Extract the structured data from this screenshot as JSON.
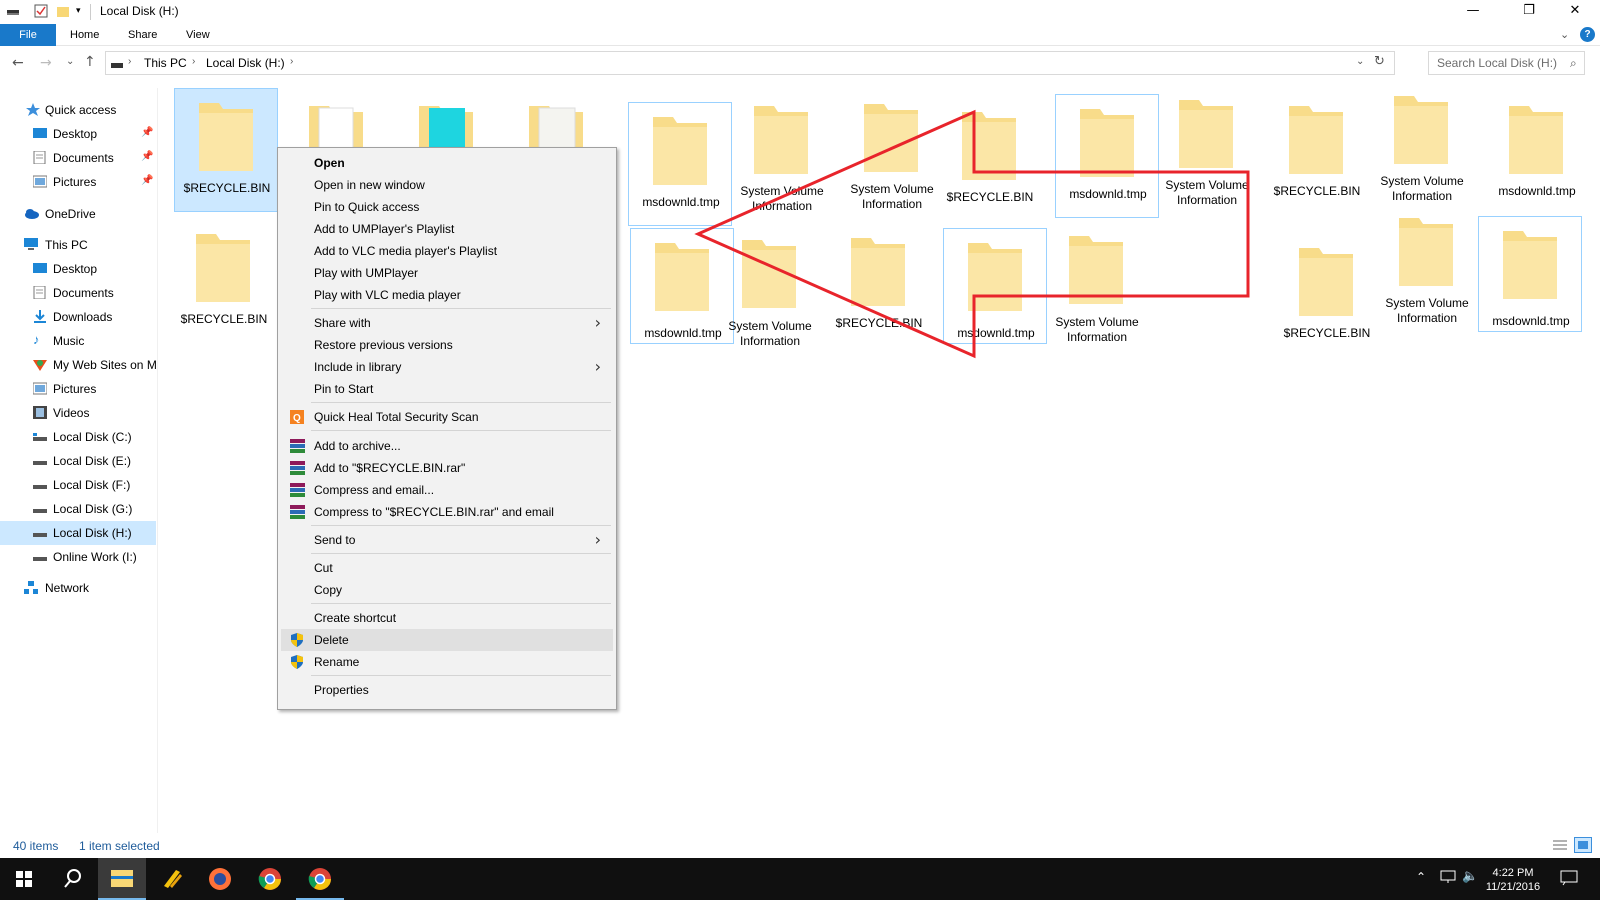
{
  "window": {
    "title": "Local Disk (H:)",
    "minimize": "—",
    "maximize": "❐",
    "close": "✕"
  },
  "ribbon": {
    "tabs": [
      "File",
      "Home",
      "Share",
      "View"
    ]
  },
  "address": {
    "crumbs": [
      "This PC",
      "Local Disk (H:)"
    ],
    "search_placeholder": "Search Local Disk (H:)"
  },
  "nav": {
    "items": [
      {
        "label": "Quick access",
        "icon": "star-icon"
      },
      {
        "label": "Desktop",
        "icon": "desktop-icon"
      },
      {
        "label": "Documents",
        "icon": "documents-icon"
      },
      {
        "label": "Pictures",
        "icon": "pictures-icon"
      },
      {
        "label": "OneDrive",
        "icon": "cloud-icon"
      },
      {
        "label": "This PC",
        "icon": "computer-icon"
      },
      {
        "label": "Desktop",
        "icon": "desktop-icon"
      },
      {
        "label": "Documents",
        "icon": "documents-icon"
      },
      {
        "label": "Downloads",
        "icon": "downloads-icon"
      },
      {
        "label": "Music",
        "icon": "music-icon"
      },
      {
        "label": "My Web Sites on M",
        "icon": "web-sites-icon"
      },
      {
        "label": "Pictures",
        "icon": "pictures-icon"
      },
      {
        "label": "Videos",
        "icon": "videos-icon"
      },
      {
        "label": "Local Disk (C:)",
        "icon": "drive-icon"
      },
      {
        "label": "Local Disk (E:)",
        "icon": "drive-icon"
      },
      {
        "label": "Local Disk (F:)",
        "icon": "drive-icon"
      },
      {
        "label": "Local Disk (G:)",
        "icon": "drive-icon"
      },
      {
        "label": "Local Disk (H:)",
        "icon": "drive-icon"
      },
      {
        "label": "Online Work (I:)",
        "icon": "drive-icon"
      },
      {
        "label": "Network",
        "icon": "network-icon"
      }
    ]
  },
  "files": {
    "row1": [
      "$RECYCLE.BIN",
      "msdownld.tmp",
      "System Volume Information",
      "System Volume Information",
      "$RECYCLE.BIN",
      "msdownld.tmp",
      "System Volume Information",
      "$RECYCLE.BIN",
      "System Volume Information",
      "msdownld.tmp"
    ],
    "row2": [
      "$RECYCLE.BIN",
      "msdownld.tmp",
      "System Volume Information",
      "$RECYCLE.BIN",
      "msdownld.tmp",
      "System Volume Information",
      "$RECYCLE.BIN",
      "System Volume Information",
      "msdownld.tmp"
    ]
  },
  "context_menu": {
    "open": "Open",
    "open_new_window": "Open in new window",
    "pin_quick_access": "Pin to Quick access",
    "add_umplayer": "Add to UMPlayer's Playlist",
    "add_vlc": "Add to VLC media player's Playlist",
    "play_umplayer": "Play with UMPlayer",
    "play_vlc": "Play with VLC media player",
    "share_with": "Share with",
    "restore_versions": "Restore previous versions",
    "include_library": "Include in library",
    "pin_start": "Pin to Start",
    "quick_heal": "Quick Heal Total Security Scan",
    "add_archive": "Add to archive...",
    "add_rar": "Add to \"$RECYCLE.BIN.rar\"",
    "compress_email": "Compress and email...",
    "compress_rar_email": "Compress to \"$RECYCLE.BIN.rar\" and email",
    "send_to": "Send to",
    "cut": "Cut",
    "copy": "Copy",
    "create_shortcut": "Create shortcut",
    "delete": "Delete",
    "rename": "Rename",
    "properties": "Properties"
  },
  "status": {
    "items": "40 items",
    "selected": "1 item selected"
  },
  "taskbar": {
    "time": "4:22 PM",
    "date": "11/21/2016"
  },
  "colors": {
    "accent": "#1979ca",
    "selection": "#cce8ff",
    "annotation": "#e8242b",
    "folder": "#f8dc8a"
  }
}
